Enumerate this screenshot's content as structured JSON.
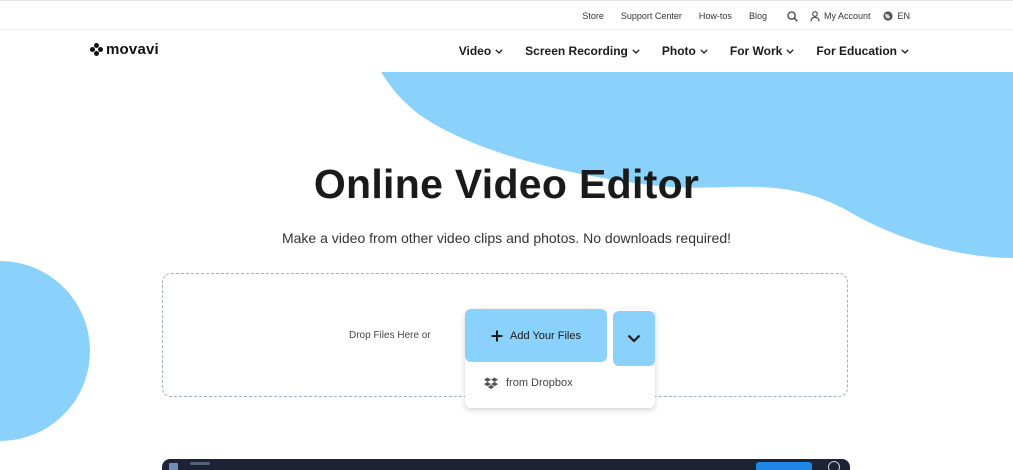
{
  "topbar": {
    "links": [
      "Store",
      "Support Center",
      "How-tos",
      "Blog"
    ],
    "search_icon": "search-icon",
    "account_label": "My Account",
    "language": "EN"
  },
  "brand": {
    "name": "movavi"
  },
  "nav": {
    "items": [
      {
        "label": "Video"
      },
      {
        "label": "Screen Recording"
      },
      {
        "label": "Photo"
      },
      {
        "label": "For Work"
      },
      {
        "label": "For Education"
      }
    ]
  },
  "hero": {
    "title": "Online Video Editor",
    "subtitle": "Make a video from other video clips and photos. No downloads required!"
  },
  "upload": {
    "drop_label": "Drop Files Here or",
    "add_button_label": "Add Your Files",
    "dropbox_label": "from Dropbox"
  },
  "colors": {
    "accent_blue": "#8ad1fb",
    "text_dark": "#1a1a1a",
    "dropzone_border": "#9ab3b8",
    "editor_bar": "#1e2235",
    "export_button": "#1f86e6"
  }
}
